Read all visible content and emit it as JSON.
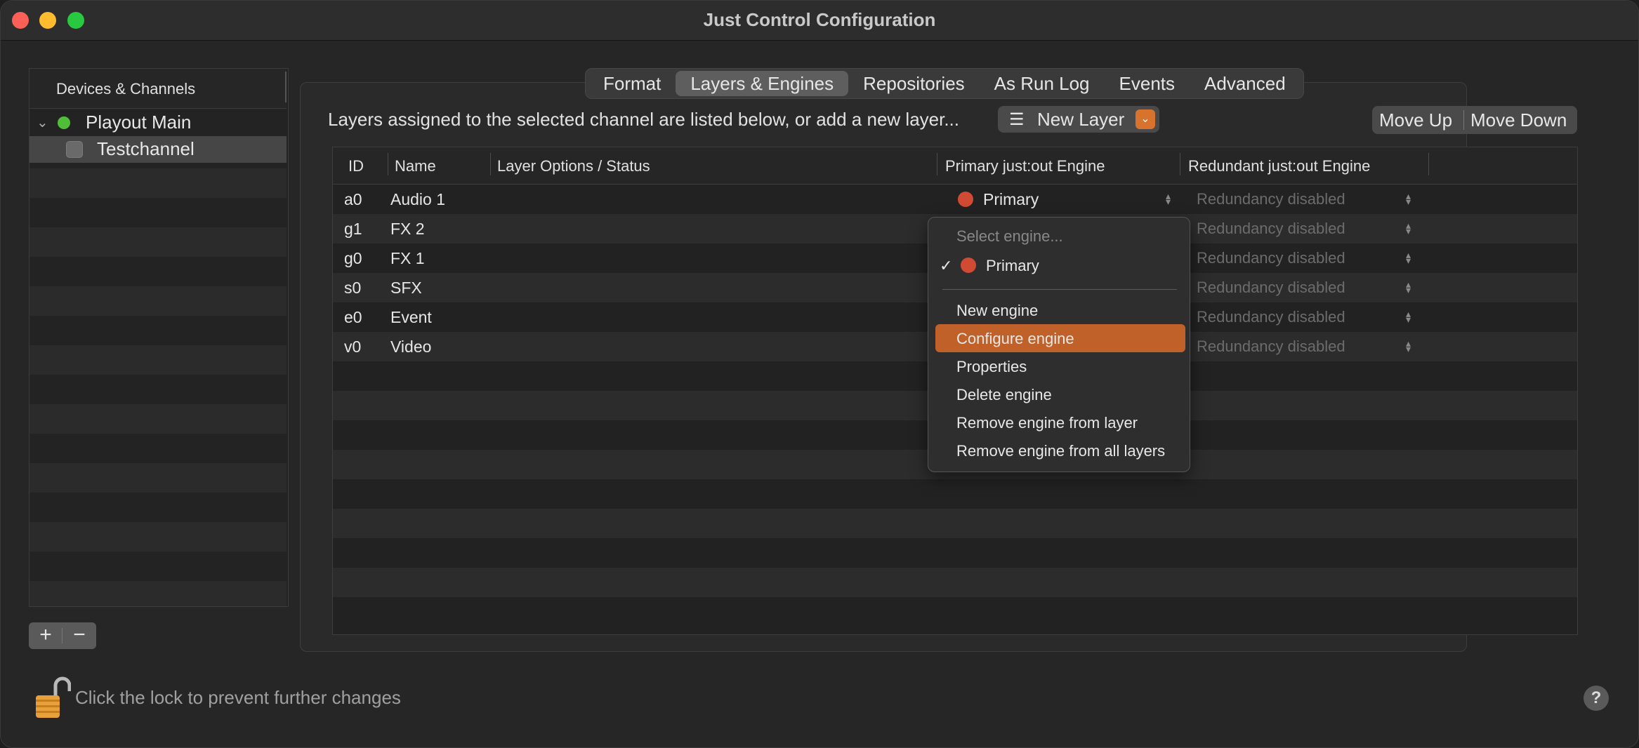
{
  "window": {
    "title": "Just Control Configuration"
  },
  "sidebar": {
    "header": "Devices & Channels",
    "items": [
      {
        "label": "Playout Main",
        "status_color": "#4fbf3a"
      },
      {
        "label": "Testchannel"
      }
    ],
    "add_label": "+",
    "remove_label": "−"
  },
  "tabs": [
    "Format",
    "Layers & Engines",
    "Repositories",
    "As Run Log",
    "Events",
    "Advanced"
  ],
  "active_tab": "Layers & Engines",
  "toolbar": {
    "hint": "Layers assigned to the selected channel are listed below, or add a new layer...",
    "new_layer_label": "New Layer",
    "move_up_label": "Move Up",
    "move_down_label": "Move Down"
  },
  "table": {
    "columns": [
      "ID",
      "Name",
      "Layer Options / Status",
      "Primary just:out Engine",
      "Redundant just:out Engine"
    ],
    "rows": [
      {
        "id": "a0",
        "name": "Audio 1",
        "primary": "Primary",
        "redundant": "Redundancy disabled"
      },
      {
        "id": "g1",
        "name": "FX 2",
        "redundant": "Redundancy disabled"
      },
      {
        "id": "g0",
        "name": "FX 1",
        "redundant": "Redundancy disabled"
      },
      {
        "id": "s0",
        "name": "SFX",
        "redundant": "Redundancy disabled"
      },
      {
        "id": "e0",
        "name": "Event",
        "redundant": "Redundancy disabled"
      },
      {
        "id": "v0",
        "name": "Video",
        "redundant": "Redundancy disabled"
      }
    ]
  },
  "engine_menu": {
    "placeholder": "Select engine...",
    "selected": "Primary",
    "items": [
      "New engine",
      "Configure engine",
      "Properties",
      "Delete engine",
      "Remove engine from layer",
      "Remove engine from all layers"
    ],
    "highlighted": "Configure engine",
    "highlight_color": "#c06129"
  },
  "footer": {
    "lock_text": "Click the lock to prevent further changes",
    "help_label": "?"
  },
  "colors": {
    "accent": "#d7732d",
    "engine_dot": "#d14a33"
  }
}
